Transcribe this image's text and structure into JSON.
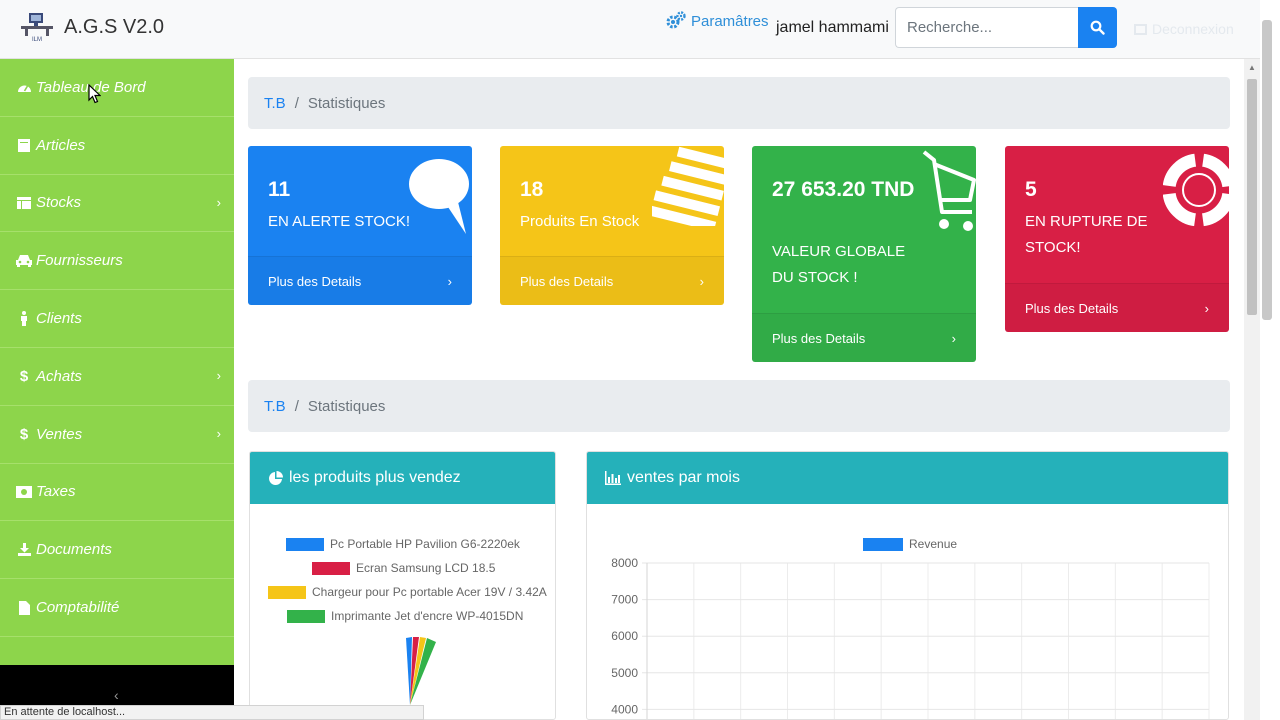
{
  "app": {
    "title": "A.G.S V2.0"
  },
  "header": {
    "params_label": "Paramâtres",
    "user_name": "jamel hammami",
    "search_placeholder": "Recherche...",
    "logout_label": "Deconnexion"
  },
  "sidebar": {
    "items": [
      {
        "label": "Tableau de Bord",
        "icon": "dashboard-icon",
        "has_submenu": false
      },
      {
        "label": "Articles",
        "icon": "article-icon",
        "has_submenu": false
      },
      {
        "label": "Stocks",
        "icon": "table-icon",
        "has_submenu": true
      },
      {
        "label": "Fournisseurs",
        "icon": "car-icon",
        "has_submenu": false
      },
      {
        "label": "Clients",
        "icon": "male-icon",
        "has_submenu": false
      },
      {
        "label": "Achats",
        "icon": "dollar-icon",
        "has_submenu": true
      },
      {
        "label": "Ventes",
        "icon": "dollar-icon",
        "has_submenu": true
      },
      {
        "label": "Taxes",
        "icon": "money-icon",
        "has_submenu": false
      },
      {
        "label": "Documents",
        "icon": "download-icon",
        "has_submenu": false
      },
      {
        "label": "Comptabilité",
        "icon": "file-icon",
        "has_submenu": false
      }
    ],
    "collapse_symbol": "‹"
  },
  "breadcrumbs": [
    {
      "link": "T.B",
      "current": "Statistiques"
    },
    {
      "link": "T.B",
      "current": "Statistiques"
    }
  ],
  "cards": [
    {
      "value": "11",
      "label": "EN ALERTE STOCK!",
      "footer": "Plus des Details",
      "color": "#1a82f1",
      "icon": "comment-icon"
    },
    {
      "value": "18",
      "label": "Produits En Stock",
      "footer": "Plus des Details",
      "color": "#f5c518",
      "icon": "list-icon"
    },
    {
      "value": "27 653.20 TND",
      "label": "VALEUR GLOBALE DU STOCK !",
      "footer": "Plus des Details",
      "color": "#33b24a",
      "icon": "cart-icon"
    },
    {
      "value": "5",
      "label": "EN RUPTURE DE STOCK!",
      "footer": "Plus des Details",
      "color": "#d81f45",
      "icon": "lifebuoy-icon"
    }
  ],
  "panels": {
    "products": {
      "title": "les produits plus vendez",
      "icon": "pie-chart-icon"
    },
    "sales": {
      "title": "ventes par mois",
      "icon": "bar-chart-icon"
    }
  },
  "chart_data": [
    {
      "type": "pie",
      "title": "",
      "legend": [
        "Pc Portable HP Pavilion G6-2220ek",
        "Ecran Samsung LCD 18.5",
        "Chargeur pour Pc portable Acer 19V / 3.42A",
        "Imprimante Jet d'encre WP-4015DN"
      ],
      "colors": [
        "#1a82f1",
        "#d81f45",
        "#f5c518",
        "#33b24a"
      ],
      "legend_position": "top"
    },
    {
      "type": "bar",
      "title": "",
      "series": [
        {
          "name": "Revenue",
          "values": []
        }
      ],
      "color": "#1a82f1",
      "ylim": [
        4000,
        8000
      ],
      "yticks": [
        8000,
        7000,
        6000,
        5000,
        4000
      ],
      "grid": true,
      "legend_position": "top"
    }
  ],
  "status_bar": {
    "text": "En attente de localhost..."
  }
}
